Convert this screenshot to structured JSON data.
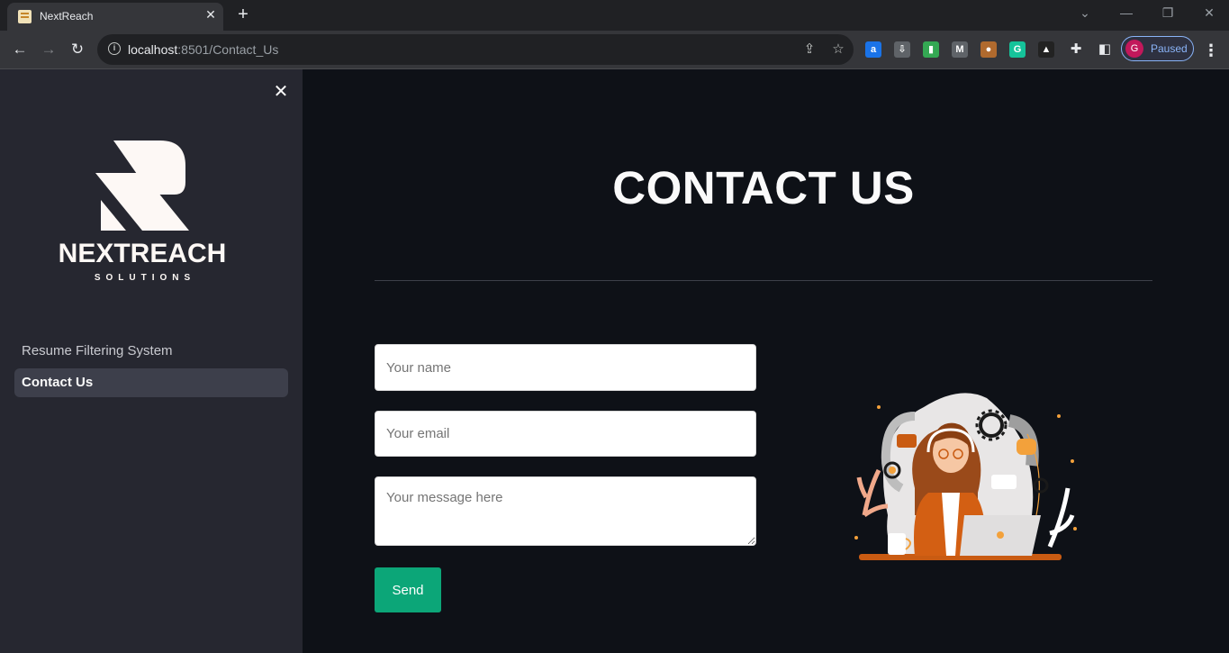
{
  "browser": {
    "tab_title": "NextReach",
    "tab_close": "✕",
    "new_tab": "+",
    "url_host": "localhost",
    "url_path": ":8501/Contact_Us",
    "profile_initial": "G",
    "profile_status": "Paused",
    "extensions": [
      {
        "icon": "a-ext-icon",
        "glyph": "a",
        "color": "#1a73e8"
      },
      {
        "icon": "save-ext-icon",
        "glyph": "⇩",
        "color": "#5f6368"
      },
      {
        "icon": "bars-ext-icon",
        "glyph": "▮",
        "color": "#34a853"
      },
      {
        "icon": "m-ext-icon",
        "glyph": "M",
        "color": "#5f6368"
      },
      {
        "icon": "cookie-ext-icon",
        "glyph": "●",
        "color": "#b06a2e"
      },
      {
        "icon": "grammarly-ext-icon",
        "glyph": "G",
        "color": "#15c39a"
      },
      {
        "icon": "bird-ext-icon",
        "glyph": "▲",
        "color": "#222"
      }
    ]
  },
  "sidebar": {
    "close_icon": "✕",
    "logo_name": "NEXTREACH",
    "logo_sub": "SOLUTIONS",
    "items": [
      {
        "label": "Resume Filtering System",
        "active": false
      },
      {
        "label": "Contact Us",
        "active": true
      }
    ]
  },
  "main": {
    "title": "CONTACT US",
    "form": {
      "name_placeholder": "Your name",
      "email_placeholder": "Your email",
      "message_placeholder": "Your message here",
      "send_label": "Send"
    }
  },
  "colors": {
    "sidebar_bg": "#262730",
    "main_bg": "#0e1117",
    "send_button": "#0ca678",
    "illustration_accent": "#c95b12"
  }
}
